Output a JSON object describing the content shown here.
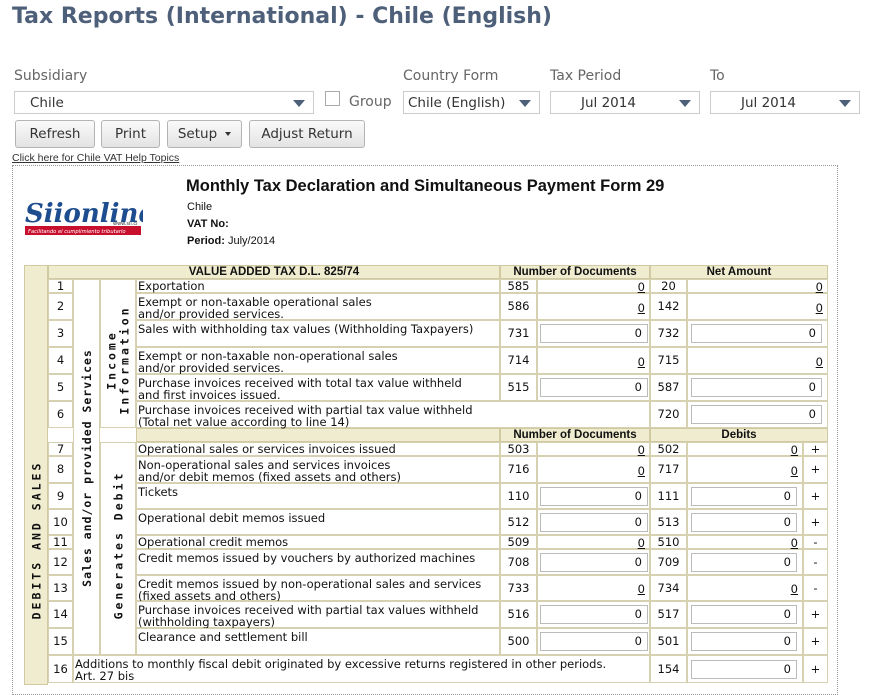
{
  "page_title": "Tax Reports (International) - Chile (English)",
  "filters": {
    "subsidiary_label": "Subsidiary",
    "subsidiary_value": "Chile",
    "group_label": "Group",
    "country_form_label": "Country Form",
    "country_form_value": "Chile (English)",
    "tax_period_label": "Tax Period",
    "tax_period_value": "Jul 2014",
    "to_label": "To",
    "to_value": "Jul 2014"
  },
  "toolbar": {
    "refresh": "Refresh",
    "print": "Print",
    "setup": "Setup",
    "adjust": "Adjust Return"
  },
  "help_link": "Click here for Chile VAT Help Topics",
  "form": {
    "title": "Monthly Tax Declaration and Simultaneous Payment Form 29",
    "country": "Chile",
    "vat_label": "VAT No:",
    "period_label": "Period:",
    "period_value": "July/2014",
    "logo_text": "Siionline",
    "logo_sub": "www.sii.cl",
    "logo_tag": "Facilitando el cumplimiento tributario"
  },
  "table": {
    "section_title": "VALUE ADDED TAX D.L. 825/74",
    "col_docs": "Number of Documents",
    "col_net": "Net Amount",
    "col_debits": "Debits",
    "vertical_main": "DEBITS AND SALES",
    "vertical_sales": "Sales and/or provided Services",
    "vertical_income": "Income Information",
    "vertical_generates": "Generates Debit",
    "rows": [
      {
        "n": "1",
        "desc": "Exportation",
        "c1": "585",
        "v1": "0",
        "c2": "20",
        "v2": "0",
        "sign": ""
      },
      {
        "n": "2",
        "desc": "Exempt or non-taxable operational sales\nand/or provided services.",
        "c1": "586",
        "v1": "0",
        "c2": "142",
        "v2": "0",
        "sign": ""
      },
      {
        "n": "3",
        "desc": "Sales with withholding tax values (Withholding Taxpayers)",
        "c1": "731",
        "v1": "0",
        "c2": "732",
        "v2": "0",
        "sign": ""
      },
      {
        "n": "4",
        "desc": "Exempt or non-taxable non-operational sales\nand/or provided services.",
        "c1": "714",
        "v1": "0",
        "c2": "715",
        "v2": "0",
        "sign": ""
      },
      {
        "n": "5",
        "desc": "Purchase invoices received with total tax value withheld\nand first invoices issued.",
        "c1": "515",
        "v1": "0",
        "c2": "587",
        "v2": "0",
        "sign": ""
      },
      {
        "n": "6",
        "desc": "Purchase invoices received with partial tax value withheld\n(Total net value according to line 14)",
        "c1": "",
        "v1": "",
        "c2": "720",
        "v2": "0",
        "sign": ""
      },
      {
        "n": "7",
        "desc": "Operational sales or services invoices issued",
        "c1": "503",
        "v1": "0",
        "c2": "502",
        "v2": "0",
        "sign": "+"
      },
      {
        "n": "8",
        "desc": "Non-operational sales and services invoices\nand/or debit memos (fixed assets and others)",
        "c1": "716",
        "v1": "0",
        "c2": "717",
        "v2": "0",
        "sign": "+"
      },
      {
        "n": "9",
        "desc": "Tickets",
        "c1": "110",
        "v1": "0",
        "c2": "111",
        "v2": "0",
        "sign": "+"
      },
      {
        "n": "10",
        "desc": "Operational debit memos issued",
        "c1": "512",
        "v1": "0",
        "c2": "513",
        "v2": "0",
        "sign": "+"
      },
      {
        "n": "11",
        "desc": "Operational credit memos",
        "c1": "509",
        "v1": "0",
        "c2": "510",
        "v2": "0",
        "sign": "-"
      },
      {
        "n": "12",
        "desc": "Credit memos issued by vouchers by authorized machines",
        "c1": "708",
        "v1": "0",
        "c2": "709",
        "v2": "0",
        "sign": "-"
      },
      {
        "n": "13",
        "desc": "Credit memos issued by non-operational sales and services\n(fixed assets and others)",
        "c1": "733",
        "v1": "0",
        "c2": "734",
        "v2": "0",
        "sign": "-"
      },
      {
        "n": "14",
        "desc": "Purchase invoices received with partial tax values withheld\n(withholding taxpayers)",
        "c1": "516",
        "v1": "0",
        "c2": "517",
        "v2": "0",
        "sign": "+"
      },
      {
        "n": "15",
        "desc": "Clearance and settlement bill",
        "c1": "500",
        "v1": "0",
        "c2": "501",
        "v2": "0",
        "sign": "+"
      },
      {
        "n": "16",
        "desc": "Additions to monthly fiscal debit originated by excessive returns registered in other periods.\nArt. 27 bis",
        "c1": "",
        "v1": "",
        "c2": "154",
        "v2": "0",
        "sign": "+"
      }
    ]
  }
}
